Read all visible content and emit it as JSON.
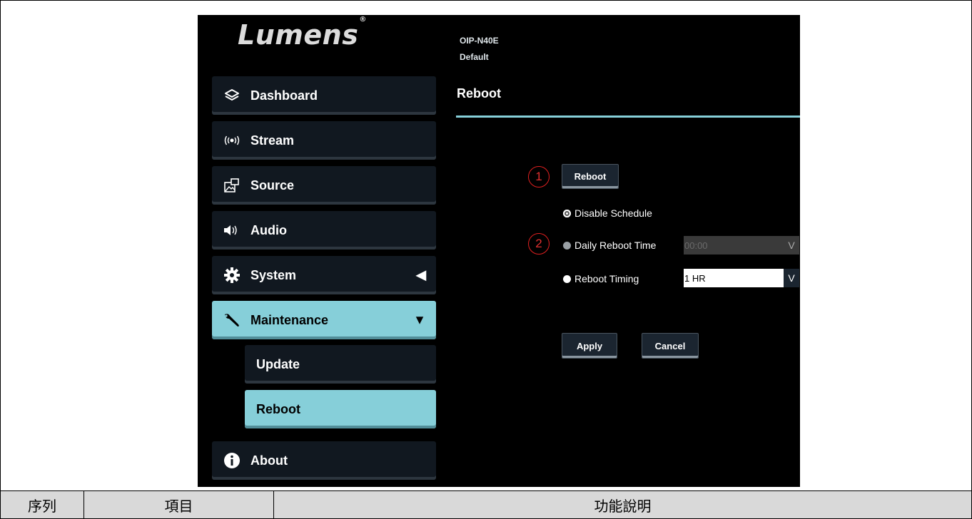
{
  "app": {
    "logo": "Lumens",
    "logo_mark": "®",
    "device": {
      "model": "OIP-N40E",
      "profile": "Default"
    }
  },
  "sidebar": {
    "items": [
      {
        "label": "Dashboard",
        "icon": "layers-icon"
      },
      {
        "label": "Stream",
        "icon": "broadcast-icon"
      },
      {
        "label": "Source",
        "icon": "image-source-icon"
      },
      {
        "label": "Audio",
        "icon": "speaker-icon"
      },
      {
        "label": "System",
        "icon": "gear-icon",
        "arrow": "◀"
      },
      {
        "label": "Maintenance",
        "icon": "wrench-icon",
        "arrow": "▼",
        "active": true
      },
      {
        "label": "About",
        "icon": "info-icon"
      }
    ],
    "subitems": [
      {
        "label": "Update"
      },
      {
        "label": "Reboot",
        "active": true
      }
    ]
  },
  "main": {
    "title": "Reboot",
    "reboot_button": "Reboot",
    "markers": [
      "1",
      "2"
    ],
    "options": {
      "disable_schedule": "Disable Schedule",
      "daily_reboot_time": "Daily Reboot Time",
      "reboot_timing": "Reboot Timing"
    },
    "daily_time_value": "00:00",
    "timing_value": "1 HR",
    "caret": "V",
    "apply_button": "Apply",
    "cancel_button": "Cancel"
  },
  "table": {
    "headers": [
      "序列",
      "項目",
      "功能說明"
    ]
  },
  "colors": {
    "accent": "#86cfd9",
    "marker": "#e02020",
    "background": "#000000",
    "nav_bg": "#111820",
    "table_header_bg": "#d9d9d9"
  }
}
